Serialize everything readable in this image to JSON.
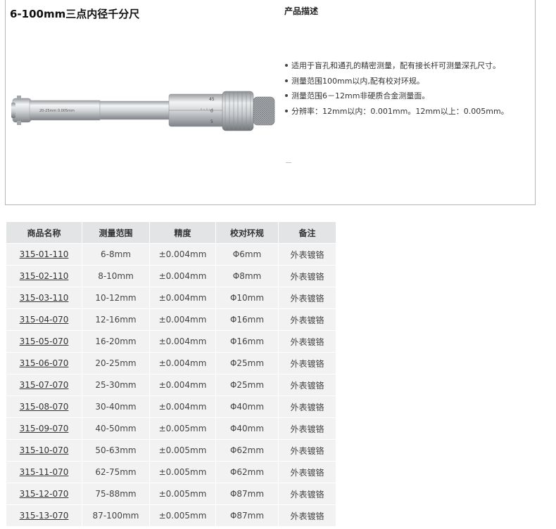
{
  "product": {
    "title": "6-100mm三点内径千分尺",
    "description_heading": "产品描述",
    "features": [
      "适用于盲孔和通孔的精密测量，配有接长杆可测量深孔尺寸。",
      "测量范围100mm以内,配有校对环规。",
      "测量范围6－12mm非硬质合金测量面。",
      "分辨率：12mm以内：0.001mm。12mm以上：0.005mm。"
    ],
    "image_labels": {
      "barrel_text": "20-25mm  0.005mm",
      "thimble_numbers": [
        "45",
        "0",
        "5"
      ]
    }
  },
  "table": {
    "headers": [
      "商品名称",
      "测量范围",
      "精度",
      "校对环规",
      "备注"
    ],
    "rows": [
      [
        "315-01-110",
        "6-8mm",
        "±0.004mm",
        "Φ6mm",
        "外表镀铬"
      ],
      [
        "315-02-110",
        "8-10mm",
        "±0.004mm",
        "Φ8mm",
        "外表镀铬"
      ],
      [
        "315-03-110",
        "10-12mm",
        "±0.004mm",
        "Φ10mm",
        "外表镀铬"
      ],
      [
        "315-04-070",
        "12-16mm",
        "±0.004mm",
        "Φ16mm",
        "外表镀铬"
      ],
      [
        "315-05-070",
        "16-20mm",
        "±0.004mm",
        "Φ16mm",
        "外表镀铬"
      ],
      [
        "315-06-070",
        "20-25mm",
        "±0.004mm",
        "Φ25mm",
        "外表镀铬"
      ],
      [
        "315-07-070",
        "25-30mm",
        "±0.004mm",
        "Φ25mm",
        "外表镀铬"
      ],
      [
        "315-08-070",
        "30-40mm",
        "±0.004mm",
        "Φ40mm",
        "外表镀铬"
      ],
      [
        "315-09-070",
        "40-50mm",
        "±0.005mm",
        "Φ40mm",
        "外表镀铬"
      ],
      [
        "315-10-070",
        "50-63mm",
        "±0.005mm",
        "Φ62mm",
        "外表镀铬"
      ],
      [
        "315-11-070",
        "62-75mm",
        "±0.005mm",
        "Φ62mm",
        "外表镀铬"
      ],
      [
        "315-12-070",
        "75-88mm",
        "±0.005mm",
        "Φ87mm",
        "外表镀铬"
      ],
      [
        "315-13-070",
        "87-100mm",
        "±0.005mm",
        "Φ87mm",
        "外表镀铬"
      ]
    ]
  }
}
